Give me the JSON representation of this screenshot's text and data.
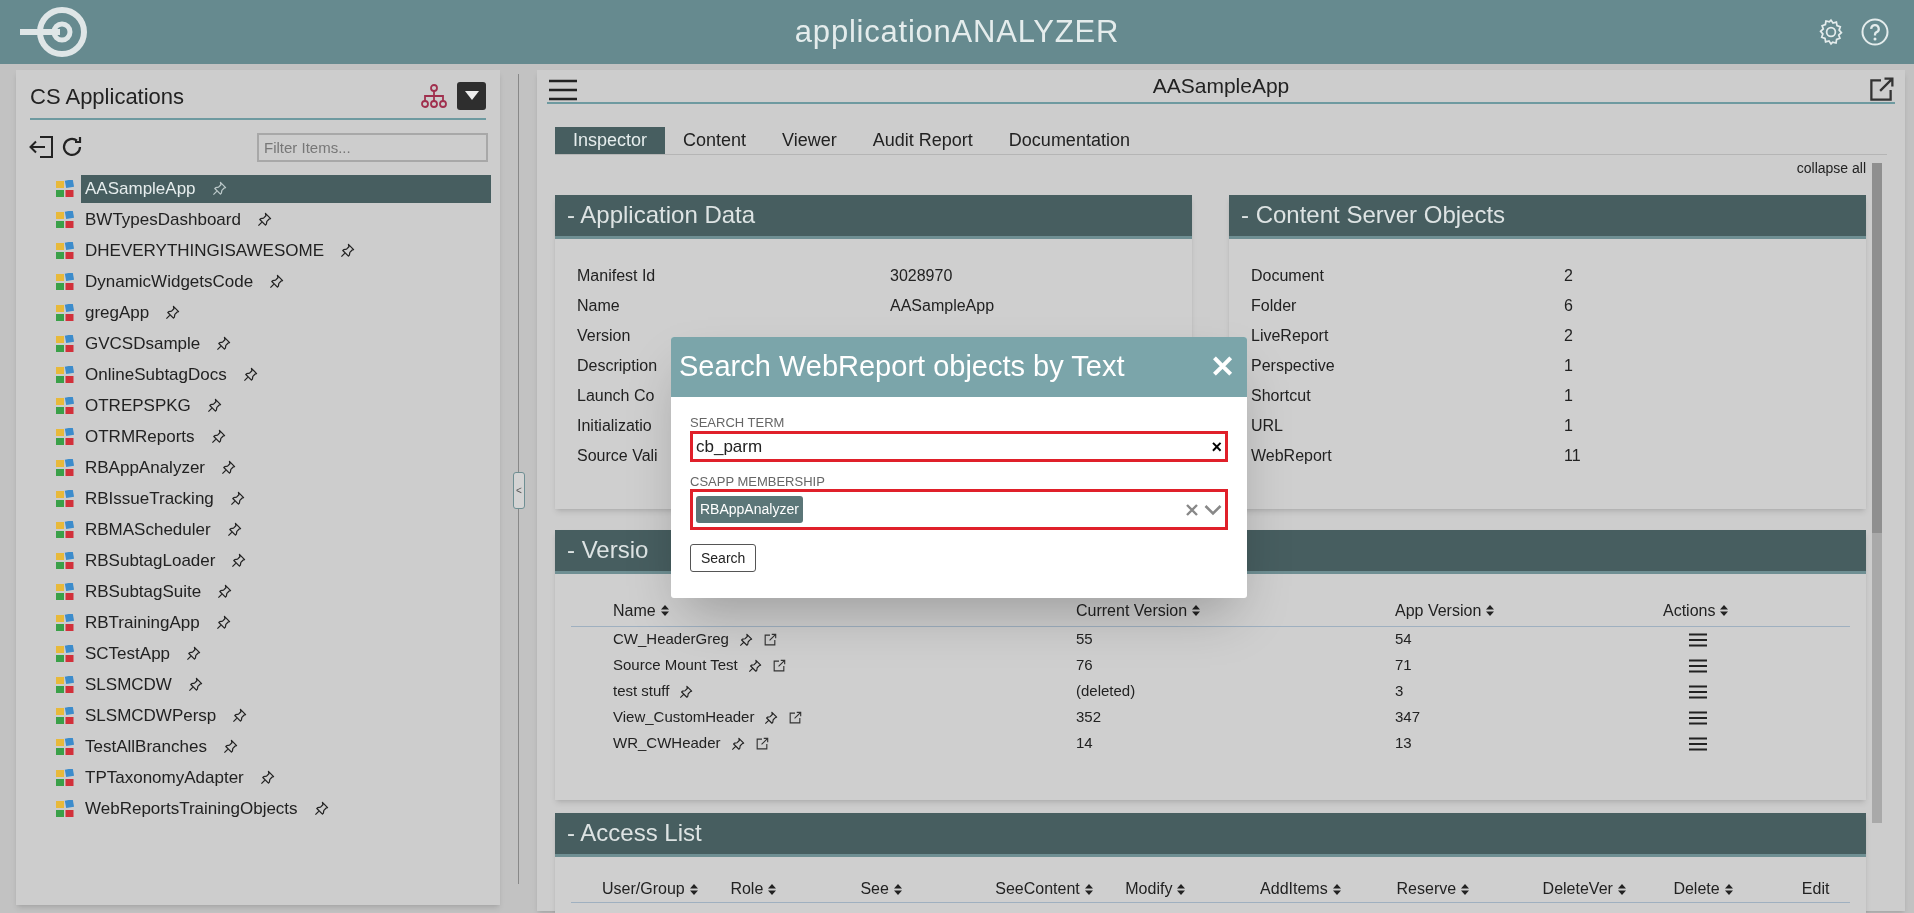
{
  "header": {
    "title": "application**ANALYZER**"
  },
  "sidebar": {
    "title": "CS Applications",
    "filter_placeholder": "Filter Items...",
    "items": [
      {
        "label": "AASampleApp",
        "selected": true
      },
      {
        "label": "BWTypesDashboard",
        "selected": false
      },
      {
        "label": "DHEVERYTHINGISAWESOME",
        "selected": false
      },
      {
        "label": "DynamicWidgetsCode",
        "selected": false
      },
      {
        "label": "gregApp",
        "selected": false
      },
      {
        "label": "GVCSDsample",
        "selected": false
      },
      {
        "label": "OnlineSubtagDocs",
        "selected": false
      },
      {
        "label": "OTREPSPKG",
        "selected": false
      },
      {
        "label": "OTRMReports",
        "selected": false
      },
      {
        "label": "RBAppAnalyzer",
        "selected": false
      },
      {
        "label": "RBIssueTracking",
        "selected": false
      },
      {
        "label": "RBMAScheduler",
        "selected": false
      },
      {
        "label": "RBSubtagLoader",
        "selected": false
      },
      {
        "label": "RBSubtagSuite",
        "selected": false
      },
      {
        "label": "RBTrainingApp",
        "selected": false
      },
      {
        "label": "SCTestApp",
        "selected": false
      },
      {
        "label": "SLSMCDW",
        "selected": false
      },
      {
        "label": "SLSMCDWPersp",
        "selected": false
      },
      {
        "label": "TestAllBranches",
        "selected": false
      },
      {
        "label": "TPTaxonomyAdapter",
        "selected": false
      },
      {
        "label": "WebReportsTrainingObjects",
        "selected": false
      }
    ],
    "collapse_handle": "<"
  },
  "main": {
    "title": "AASampleApp",
    "tabs": [
      {
        "label": "Inspector",
        "selected": true
      },
      {
        "label": "Content",
        "selected": false
      },
      {
        "label": "Viewer",
        "selected": false
      },
      {
        "label": "Audit Report",
        "selected": false
      },
      {
        "label": "Documentation",
        "selected": false
      }
    ],
    "collapse_all": "collapse all",
    "application_data": {
      "title": "- Application Data",
      "rows": [
        {
          "label": "Manifest Id",
          "value": "3028970"
        },
        {
          "label": "Name",
          "value": "AASampleApp"
        },
        {
          "label": "Version"
        },
        {
          "label": "Description"
        },
        {
          "label": "Launch Co"
        },
        {
          "label": "Initializatio"
        },
        {
          "label": "Source Vali"
        }
      ]
    },
    "content_server_objects": {
      "title": "- Content Server Objects",
      "rows": [
        {
          "label": "Document",
          "value": "2"
        },
        {
          "label": "Folder",
          "value": "6"
        },
        {
          "label": "LiveReport",
          "value": "2"
        },
        {
          "label": "Perspective",
          "value": "1"
        },
        {
          "label": "Shortcut",
          "value": "1"
        },
        {
          "label": "URL",
          "value": "1"
        },
        {
          "label": "WebReport",
          "value": "11"
        }
      ]
    },
    "versions": {
      "title": "- Versio",
      "columns": [
        "Name",
        "Current Version",
        "App Version",
        "Actions"
      ],
      "rows": [
        {
          "name": "CW_HeaderGreg",
          "linked": true,
          "current": "55",
          "app": "54"
        },
        {
          "name": "Source Mount Test",
          "linked": true,
          "current": "76",
          "app": "71"
        },
        {
          "name": "test stuff",
          "linked": false,
          "current": "(deleted)",
          "app": "3"
        },
        {
          "name": "View_CustomHeader",
          "linked": true,
          "current": "352",
          "app": "347"
        },
        {
          "name": "WR_CWHeader",
          "linked": true,
          "current": "14",
          "app": "13"
        }
      ]
    },
    "access_list": {
      "title": "- Access List",
      "columns": [
        "User/Group",
        "Role",
        "See",
        "SeeContent",
        "Modify",
        "AddItems",
        "Reserve",
        "DeleteVer",
        "Delete",
        "Edit"
      ]
    }
  },
  "dialog": {
    "title": "Search WebReport objects by Text",
    "close": "✕",
    "search_term": {
      "label": "SEARCH TERM",
      "value": "cb_parm",
      "clear": "×"
    },
    "membership": {
      "label": "CSAPP MEMBERSHIP",
      "chips": [
        "RBAppAnalyzer"
      ]
    },
    "button": "Search"
  }
}
